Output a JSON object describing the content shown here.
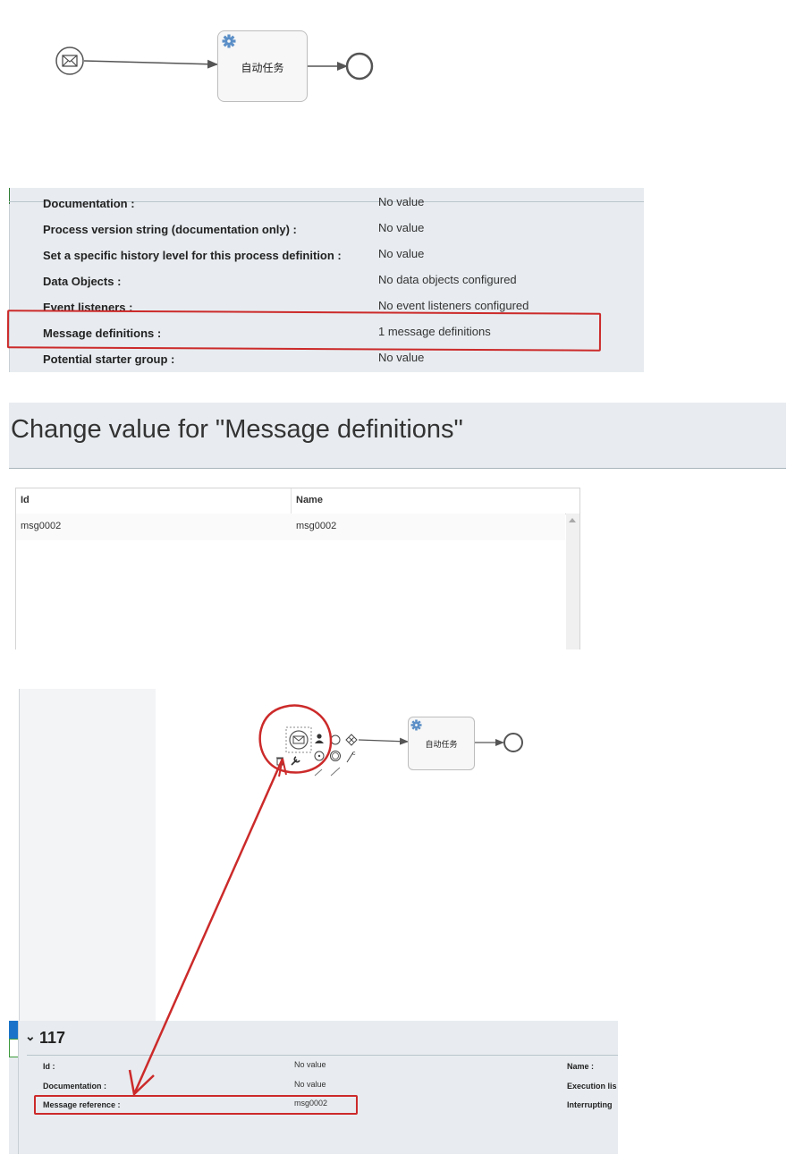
{
  "diagram_top": {
    "task_label": "自动任务",
    "start_event_icon": "message-envelope-icon",
    "task_icon": "gear-icon"
  },
  "process_properties": {
    "rows": [
      {
        "label": "Documentation :",
        "value": "No value"
      },
      {
        "label": "Process version string (documentation only) :",
        "value": "No value"
      },
      {
        "label": "Set a specific history level for this process definition :",
        "value": "No value"
      },
      {
        "label": "Data Objects :",
        "value": "No data objects configured"
      },
      {
        "label": "Event listeners :",
        "value": "No event listeners configured"
      },
      {
        "label": "Message definitions :",
        "value": "1 message definitions"
      },
      {
        "label": "Potential starter group :",
        "value": "No value"
      }
    ],
    "highlight_color": "#cc2a2a"
  },
  "message_dialog": {
    "title": "Change value for \"Message definitions\"",
    "columns": [
      "Id",
      "Name"
    ],
    "rows": [
      {
        "id": "msg0002",
        "name": "msg0002"
      }
    ]
  },
  "editor": {
    "task_label": "自动任务",
    "panel": {
      "title": "117",
      "left_fields": [
        {
          "label": "Id :",
          "value": "No value"
        },
        {
          "label": "Documentation :",
          "value": "No value"
        },
        {
          "label": "Message reference :",
          "value": "msg0002"
        }
      ],
      "right_fields": [
        {
          "label": "Name :"
        },
        {
          "label": "Execution lis"
        },
        {
          "label": "Interrupting"
        }
      ]
    }
  }
}
